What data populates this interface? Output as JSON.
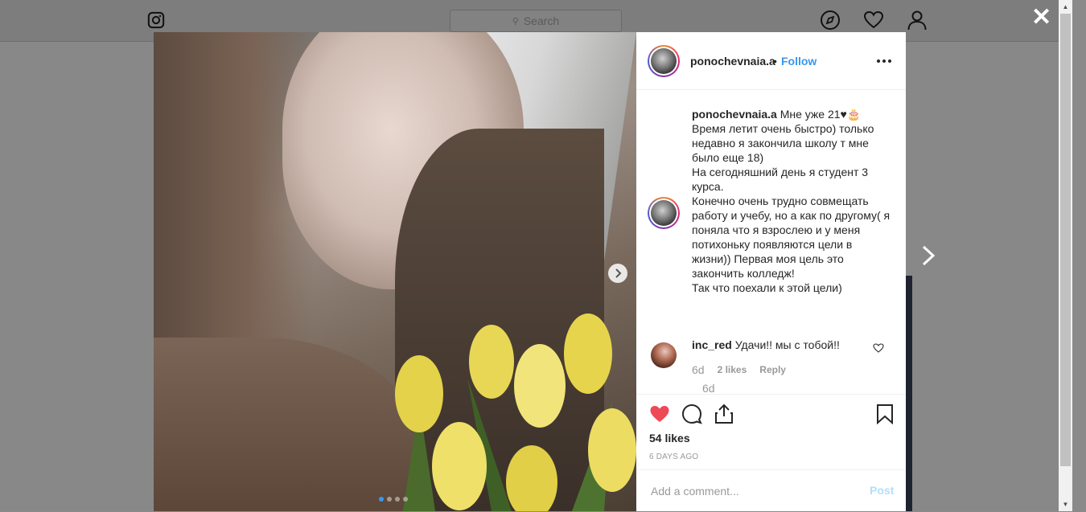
{
  "background": {
    "search_placeholder": "Search",
    "icons": [
      "instagram-logo-icon",
      "compass-icon",
      "heart-icon",
      "user-icon"
    ]
  },
  "modal": {
    "close_glyph": "✕",
    "post": {
      "author": "ponochevnaia.a",
      "separator": "•",
      "follow_label": "Follow",
      "caption_text": "Мне уже 21♥🎂 Время летит очень быстро) только недавно я закончила школу т мне было еще 18)\nНа сегодняшний день я студент 3 курса.\nКонечно очень трудно совмещать работу и учебу, но а как по другому( я поняла что я взрослею и у меня потихоньку появляются цели в жизни)) Первая моя цель это закончить колледж!\nТак что поехали к этой цели)",
      "caption_time": "6d",
      "comments": [
        {
          "user": "inc_red",
          "text": "Удачи!! мы с тобой!!",
          "time": "6d",
          "likes": "2 likes",
          "reply_label": "Reply"
        }
      ],
      "likes_label": "54 likes",
      "posted_ago": "6 DAYS AGO",
      "comment_placeholder": "Add a comment...",
      "post_label": "Post",
      "carousel": {
        "slides": 4,
        "active": 1
      }
    }
  },
  "colors": {
    "accent": "#3897f0",
    "like_red": "#ed4956",
    "post_disabled": "#b2dffc",
    "muted": "#999999"
  }
}
